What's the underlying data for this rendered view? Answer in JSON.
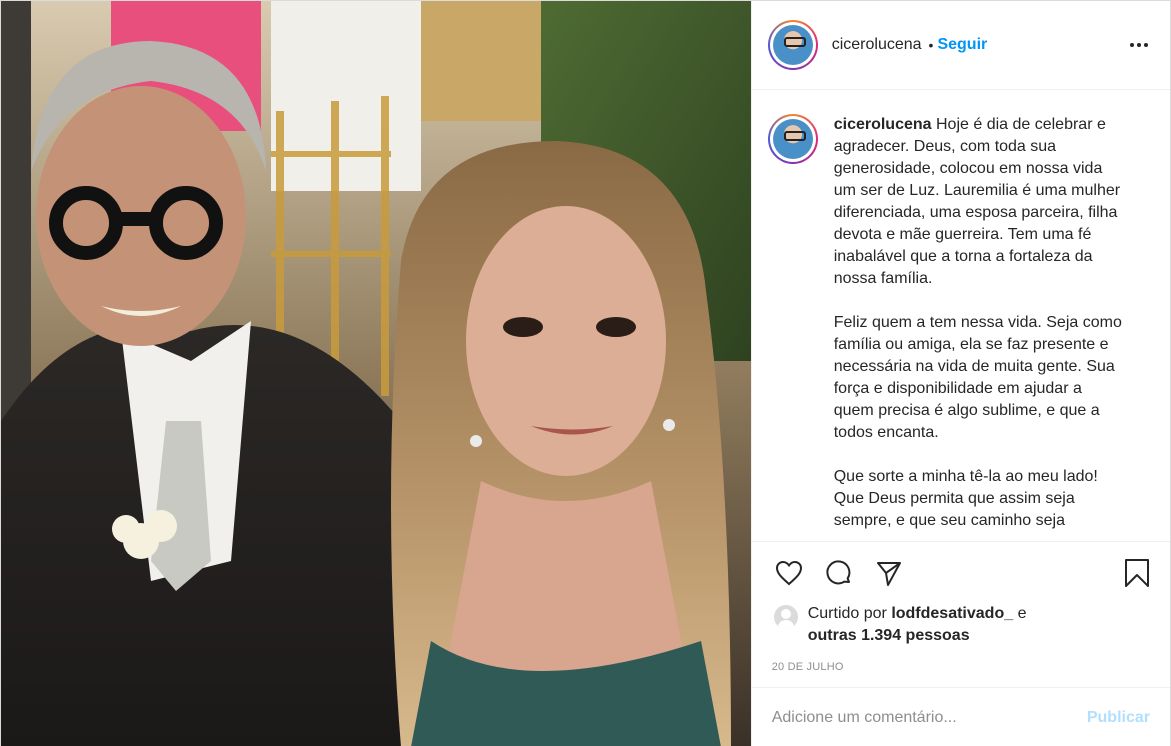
{
  "post": {
    "image_alt": "Foto de casal em uma festa",
    "header": {
      "username": "cicerolucena",
      "separator": "•",
      "follow_label": "Seguir",
      "more_icon": "more-options-icon"
    },
    "caption": {
      "username": "cicerolucena",
      "text": " Hoje é dia de celebrar e agradecer. Deus, com toda sua generosidade, colocou em nossa vida um ser de Luz. Lauremilia é uma mulher diferenciada, uma esposa parceira, filha devota e mãe guerreira. Tem uma fé inabalável que a torna a fortaleza da nossa família.\n\nFeliz quem a tem nessa vida. Seja como família ou amiga, ela se faz presente e necessária na vida de muita gente. Sua força e disponibilidade em ajudar a quem precisa é algo sublime, e que a todos encanta.\n\nQue sorte a minha tê-la ao meu lado! Que Deus permita que assim seja sempre, e que seu caminho seja"
    },
    "actions": {
      "like_icon": "heart-icon",
      "comment_icon": "comment-icon",
      "share_icon": "share-icon",
      "save_icon": "bookmark-icon"
    },
    "likes": {
      "prefix": "Curtido por ",
      "user": "lodfdesativado_",
      "connector": " e",
      "others": "outras 1.394 pessoas"
    },
    "date": "20 DE JULHO",
    "comment": {
      "placeholder": "Adicione um comentário...",
      "publish_label": "Publicar"
    },
    "colors": {
      "accent": "#0095f6",
      "publish_disabled": "#b2dffc",
      "muted": "#8e8e8e",
      "text": "#262626"
    }
  }
}
